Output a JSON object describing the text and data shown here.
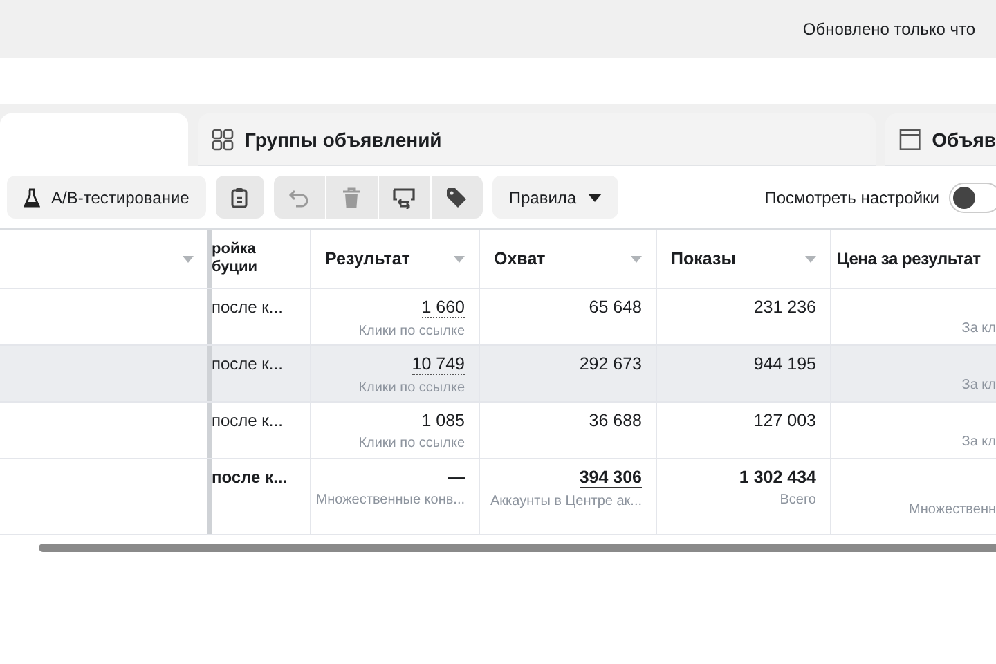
{
  "status": {
    "updated": "Обновлено только что"
  },
  "tabs": [
    {
      "kind": "blank",
      "selected": true
    },
    {
      "kind": "grid",
      "label": "Группы объявлений",
      "selected": false
    },
    {
      "kind": "window",
      "label": "Объяв",
      "selected": false
    }
  ],
  "toolbar": {
    "ab_test": "A/B-тестирование",
    "icon_buttons": [
      {
        "kind": "clipboard",
        "disabled": false
      }
    ],
    "edit_group": [
      {
        "kind": "undo",
        "disabled": true
      },
      {
        "kind": "trash",
        "disabled": true
      },
      {
        "kind": "swap",
        "disabled": false
      },
      {
        "kind": "tag",
        "disabled": false
      }
    ],
    "rules": "Правила",
    "view_settings": {
      "label": "Посмотреть настройки",
      "on": false
    }
  },
  "table": {
    "columns": [
      {
        "sortable": true
      },
      {
        "label": "ройка буции",
        "sortable": false
      },
      {
        "label": "Результат",
        "sortable": true
      },
      {
        "label": "Охват",
        "sortable": true
      },
      {
        "label": "Показы",
        "sortable": true
      },
      {
        "label": "Цена за результат",
        "sortable": false
      }
    ],
    "rows": [
      {
        "hovered": false,
        "attribution": "после к...",
        "result": "1 660",
        "result_dotted": true,
        "result_sub": "Клики по ссылке",
        "reach": "65 648",
        "impressions": "231 236",
        "cost_sub": "За кл"
      },
      {
        "hovered": true,
        "attribution": "после к...",
        "result": "10 749",
        "result_dotted": true,
        "result_sub": "Клики по ссылке",
        "reach": "292 673",
        "impressions": "944 195",
        "cost_sub": "За кл"
      },
      {
        "hovered": false,
        "attribution": "после к...",
        "result": "1 085",
        "result_dotted": false,
        "result_sub": "Клики по ссылке",
        "reach": "36 688",
        "impressions": "127 003",
        "cost_sub": "За кл"
      }
    ],
    "total": {
      "attribution": "после к...",
      "result": "—",
      "result_sub": "Множественные конв...",
      "reach": "394 306",
      "reach_sub": "Аккаунты в Центре ак...",
      "impressions": "1 302 434",
      "impressions_sub": "Всего",
      "cost_sub": "Множественн"
    }
  }
}
